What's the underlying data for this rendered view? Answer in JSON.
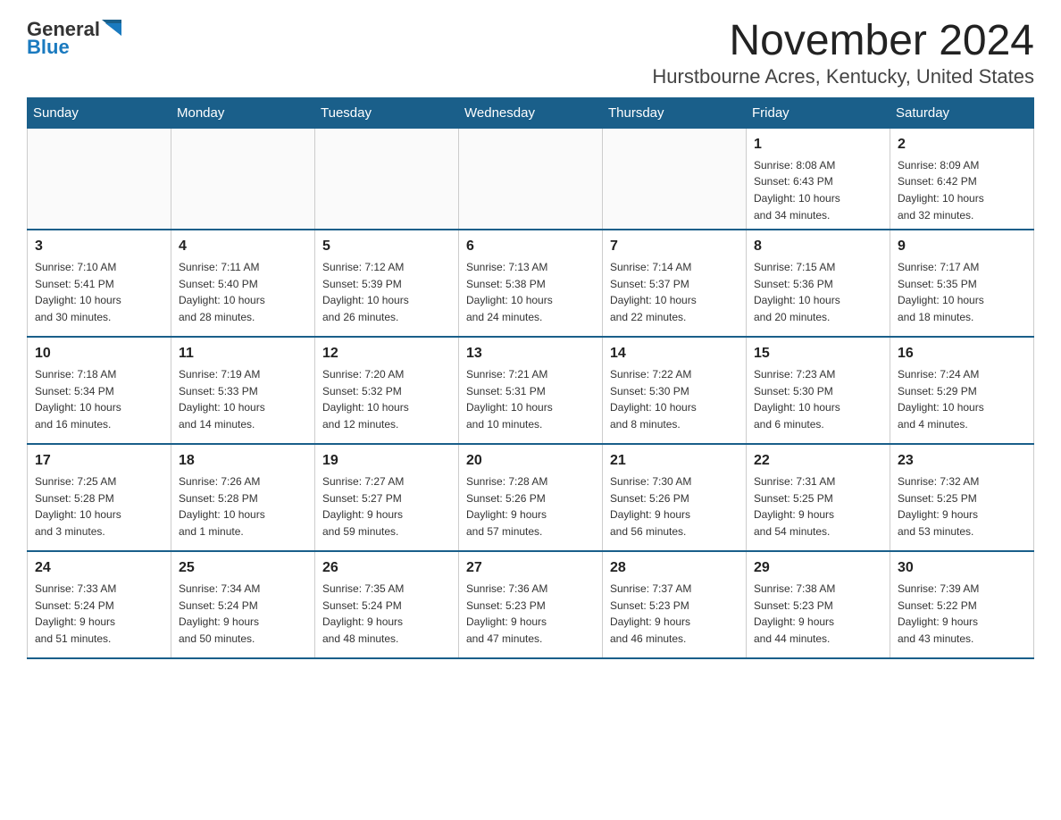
{
  "header": {
    "logo": {
      "text_general": "General",
      "text_blue": "Blue",
      "icon_alt": "GeneralBlue logo arrow"
    },
    "title": "November 2024",
    "subtitle": "Hurstbourne Acres, Kentucky, United States"
  },
  "weekdays": [
    "Sunday",
    "Monday",
    "Tuesday",
    "Wednesday",
    "Thursday",
    "Friday",
    "Saturday"
  ],
  "weeks": [
    {
      "days": [
        {
          "num": "",
          "info": ""
        },
        {
          "num": "",
          "info": ""
        },
        {
          "num": "",
          "info": ""
        },
        {
          "num": "",
          "info": ""
        },
        {
          "num": "",
          "info": ""
        },
        {
          "num": "1",
          "info": "Sunrise: 8:08 AM\nSunset: 6:43 PM\nDaylight: 10 hours\nand 34 minutes."
        },
        {
          "num": "2",
          "info": "Sunrise: 8:09 AM\nSunset: 6:42 PM\nDaylight: 10 hours\nand 32 minutes."
        }
      ]
    },
    {
      "days": [
        {
          "num": "3",
          "info": "Sunrise: 7:10 AM\nSunset: 5:41 PM\nDaylight: 10 hours\nand 30 minutes."
        },
        {
          "num": "4",
          "info": "Sunrise: 7:11 AM\nSunset: 5:40 PM\nDaylight: 10 hours\nand 28 minutes."
        },
        {
          "num": "5",
          "info": "Sunrise: 7:12 AM\nSunset: 5:39 PM\nDaylight: 10 hours\nand 26 minutes."
        },
        {
          "num": "6",
          "info": "Sunrise: 7:13 AM\nSunset: 5:38 PM\nDaylight: 10 hours\nand 24 minutes."
        },
        {
          "num": "7",
          "info": "Sunrise: 7:14 AM\nSunset: 5:37 PM\nDaylight: 10 hours\nand 22 minutes."
        },
        {
          "num": "8",
          "info": "Sunrise: 7:15 AM\nSunset: 5:36 PM\nDaylight: 10 hours\nand 20 minutes."
        },
        {
          "num": "9",
          "info": "Sunrise: 7:17 AM\nSunset: 5:35 PM\nDaylight: 10 hours\nand 18 minutes."
        }
      ]
    },
    {
      "days": [
        {
          "num": "10",
          "info": "Sunrise: 7:18 AM\nSunset: 5:34 PM\nDaylight: 10 hours\nand 16 minutes."
        },
        {
          "num": "11",
          "info": "Sunrise: 7:19 AM\nSunset: 5:33 PM\nDaylight: 10 hours\nand 14 minutes."
        },
        {
          "num": "12",
          "info": "Sunrise: 7:20 AM\nSunset: 5:32 PM\nDaylight: 10 hours\nand 12 minutes."
        },
        {
          "num": "13",
          "info": "Sunrise: 7:21 AM\nSunset: 5:31 PM\nDaylight: 10 hours\nand 10 minutes."
        },
        {
          "num": "14",
          "info": "Sunrise: 7:22 AM\nSunset: 5:30 PM\nDaylight: 10 hours\nand 8 minutes."
        },
        {
          "num": "15",
          "info": "Sunrise: 7:23 AM\nSunset: 5:30 PM\nDaylight: 10 hours\nand 6 minutes."
        },
        {
          "num": "16",
          "info": "Sunrise: 7:24 AM\nSunset: 5:29 PM\nDaylight: 10 hours\nand 4 minutes."
        }
      ]
    },
    {
      "days": [
        {
          "num": "17",
          "info": "Sunrise: 7:25 AM\nSunset: 5:28 PM\nDaylight: 10 hours\nand 3 minutes."
        },
        {
          "num": "18",
          "info": "Sunrise: 7:26 AM\nSunset: 5:28 PM\nDaylight: 10 hours\nand 1 minute."
        },
        {
          "num": "19",
          "info": "Sunrise: 7:27 AM\nSunset: 5:27 PM\nDaylight: 9 hours\nand 59 minutes."
        },
        {
          "num": "20",
          "info": "Sunrise: 7:28 AM\nSunset: 5:26 PM\nDaylight: 9 hours\nand 57 minutes."
        },
        {
          "num": "21",
          "info": "Sunrise: 7:30 AM\nSunset: 5:26 PM\nDaylight: 9 hours\nand 56 minutes."
        },
        {
          "num": "22",
          "info": "Sunrise: 7:31 AM\nSunset: 5:25 PM\nDaylight: 9 hours\nand 54 minutes."
        },
        {
          "num": "23",
          "info": "Sunrise: 7:32 AM\nSunset: 5:25 PM\nDaylight: 9 hours\nand 53 minutes."
        }
      ]
    },
    {
      "days": [
        {
          "num": "24",
          "info": "Sunrise: 7:33 AM\nSunset: 5:24 PM\nDaylight: 9 hours\nand 51 minutes."
        },
        {
          "num": "25",
          "info": "Sunrise: 7:34 AM\nSunset: 5:24 PM\nDaylight: 9 hours\nand 50 minutes."
        },
        {
          "num": "26",
          "info": "Sunrise: 7:35 AM\nSunset: 5:24 PM\nDaylight: 9 hours\nand 48 minutes."
        },
        {
          "num": "27",
          "info": "Sunrise: 7:36 AM\nSunset: 5:23 PM\nDaylight: 9 hours\nand 47 minutes."
        },
        {
          "num": "28",
          "info": "Sunrise: 7:37 AM\nSunset: 5:23 PM\nDaylight: 9 hours\nand 46 minutes."
        },
        {
          "num": "29",
          "info": "Sunrise: 7:38 AM\nSunset: 5:23 PM\nDaylight: 9 hours\nand 44 minutes."
        },
        {
          "num": "30",
          "info": "Sunrise: 7:39 AM\nSunset: 5:22 PM\nDaylight: 9 hours\nand 43 minutes."
        }
      ]
    }
  ]
}
